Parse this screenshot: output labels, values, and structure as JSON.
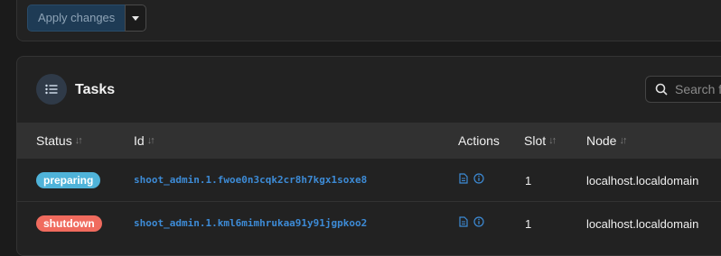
{
  "toolbar": {
    "apply_label": "Apply changes"
  },
  "tasks": {
    "title": "Tasks",
    "search_placeholder": "Search f",
    "columns": [
      "Status",
      "Id",
      "Actions",
      "Slot",
      "Node"
    ],
    "rows": [
      {
        "status": "preparing",
        "id": "shoot_admin.1.fwoe0n3cqk2cr8h7kgx1soxe8",
        "slot": "1",
        "node": "localhost.localdomain"
      },
      {
        "status": "shutdown",
        "id": "shoot_admin.1.kml6mimhrukaa91y91jgpkoo2",
        "slot": "1",
        "node": "localhost.localdomain"
      }
    ]
  },
  "colors": {
    "preparing": "#4fb3d9",
    "shutdown": "#f06b5e",
    "link": "#3d8bd6",
    "accent": "#1e3b55"
  },
  "icons": {
    "tasks": "list-icon",
    "search": "search-icon",
    "logs": "document-icon",
    "inspect": "info-icon"
  }
}
